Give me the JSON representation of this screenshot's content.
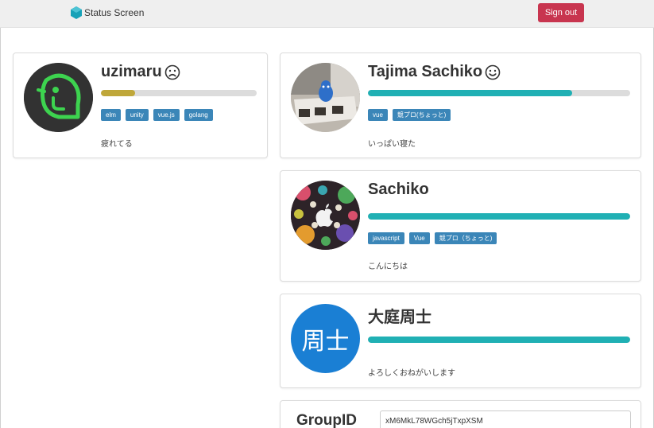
{
  "app": {
    "brand_title": "Status Screen",
    "brand_color": "#17a2b8",
    "signout_label": "Sign out",
    "signout_color": "#c8354f"
  },
  "users": [
    {
      "name": "uzimaru",
      "mood": "sad-face-icon",
      "progress": 0.22,
      "bar_color": "#bfa73a",
      "tags": [
        "elm",
        "unity",
        "vue.js",
        "golang"
      ],
      "status": "疲れてる"
    },
    {
      "name": "Tajima Sachiko",
      "mood": "smile-face-icon",
      "progress": 0.78,
      "bar_color": "#20b0b4",
      "tags": [
        "vue",
        "競プロ(ちょっと)"
      ],
      "status": "いっぱい寝た"
    },
    {
      "name": "Sachiko",
      "mood": "",
      "progress": 1.0,
      "bar_color": "#20b0b4",
      "tags": [
        "javascript",
        "Vue",
        "競プロ（ちょっと)"
      ],
      "status": "こんにちは"
    },
    {
      "name": "大庭周士",
      "mood": "",
      "progress": 1.0,
      "bar_color": "#20b0b4",
      "avatar_text": "周士",
      "avatar_color": "#1a7fd4",
      "tags": [],
      "status": "よろしくおねがいします"
    }
  ],
  "group": {
    "label": "GroupID",
    "value": "xM6MkL78WGch5jTxpXSM"
  }
}
